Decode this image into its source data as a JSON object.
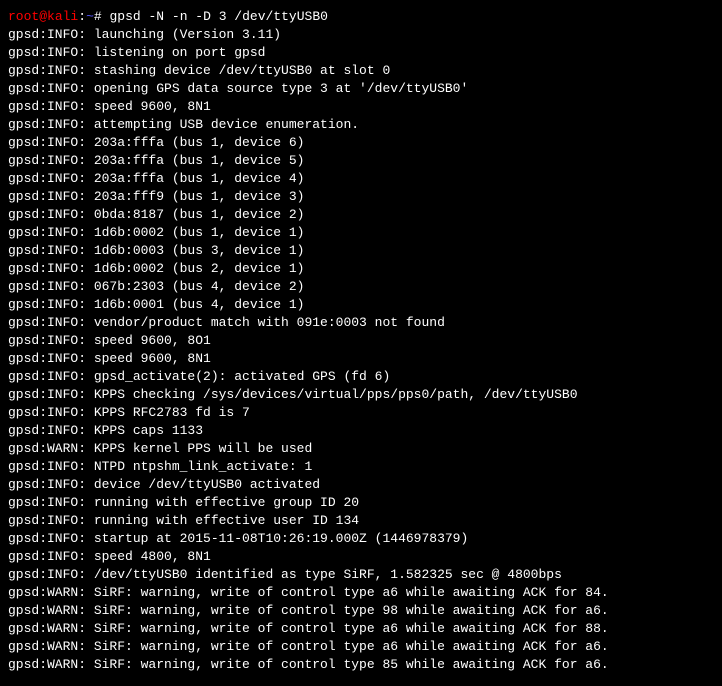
{
  "prompt": {
    "user": "root",
    "at": "@",
    "host": "kali",
    "colon": ":",
    "path": "~",
    "hash": "# ",
    "command": "gpsd -N -n -D 3 /dev/ttyUSB0"
  },
  "lines": [
    "gpsd:INFO: launching (Version 3.11)",
    "gpsd:INFO: listening on port gpsd",
    "gpsd:INFO: stashing device /dev/ttyUSB0 at slot 0",
    "gpsd:INFO: opening GPS data source type 3 at '/dev/ttyUSB0'",
    "gpsd:INFO: speed 9600, 8N1",
    "gpsd:INFO: attempting USB device enumeration.",
    "gpsd:INFO: 203a:fffa (bus 1, device 6)",
    "gpsd:INFO: 203a:fffa (bus 1, device 5)",
    "gpsd:INFO: 203a:fffa (bus 1, device 4)",
    "gpsd:INFO: 203a:fff9 (bus 1, device 3)",
    "gpsd:INFO: 0bda:8187 (bus 1, device 2)",
    "gpsd:INFO: 1d6b:0002 (bus 1, device 1)",
    "gpsd:INFO: 1d6b:0003 (bus 3, device 1)",
    "gpsd:INFO: 1d6b:0002 (bus 2, device 1)",
    "gpsd:INFO: 067b:2303 (bus 4, device 2)",
    "gpsd:INFO: 1d6b:0001 (bus 4, device 1)",
    "gpsd:INFO: vendor/product match with 091e:0003 not found",
    "gpsd:INFO: speed 9600, 8O1",
    "gpsd:INFO: speed 9600, 8N1",
    "gpsd:INFO: gpsd_activate(2): activated GPS (fd 6)",
    "gpsd:INFO: KPPS checking /sys/devices/virtual/pps/pps0/path, /dev/ttyUSB0",
    "gpsd:INFO: KPPS RFC2783 fd is 7",
    "gpsd:INFO: KPPS caps 1133",
    "gpsd:WARN: KPPS kernel PPS will be used",
    "gpsd:INFO: NTPD ntpshm_link_activate: 1",
    "gpsd:INFO: device /dev/ttyUSB0 activated",
    "gpsd:INFO: running with effective group ID 20",
    "gpsd:INFO: running with effective user ID 134",
    "gpsd:INFO: startup at 2015-11-08T10:26:19.000Z (1446978379)",
    "gpsd:INFO: speed 4800, 8N1",
    "gpsd:INFO: /dev/ttyUSB0 identified as type SiRF, 1.582325 sec @ 4800bps",
    "gpsd:WARN: SiRF: warning, write of control type a6 while awaiting ACK for 84.",
    "gpsd:WARN: SiRF: warning, write of control type 98 while awaiting ACK for a6.",
    "gpsd:WARN: SiRF: warning, write of control type a6 while awaiting ACK for 88.",
    "gpsd:WARN: SiRF: warning, write of control type a6 while awaiting ACK for a6.",
    "gpsd:WARN: SiRF: warning, write of control type 85 while awaiting ACK for a6."
  ]
}
